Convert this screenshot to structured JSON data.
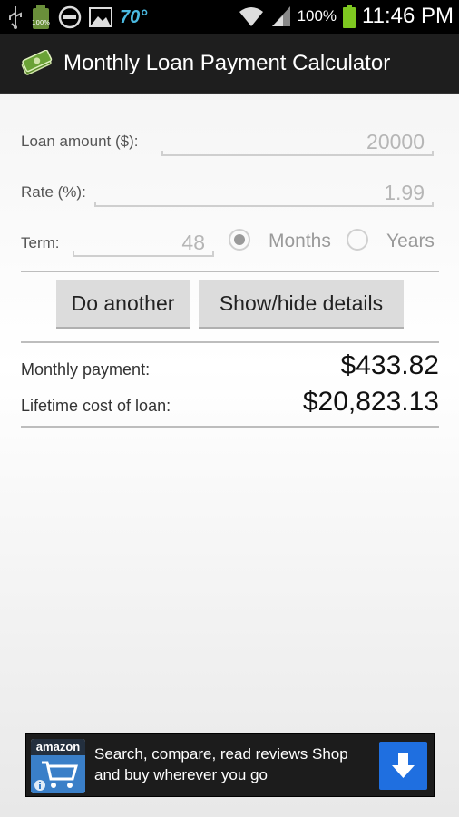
{
  "status_bar": {
    "temperature": "70°",
    "battery_percent": "100%",
    "time": "11:46 PM",
    "icons": [
      "usb-icon",
      "battery-app-icon",
      "do-not-disturb-icon",
      "gallery-icon",
      "wifi-icon",
      "signal-icon",
      "battery-icon"
    ]
  },
  "app": {
    "title": "Monthly Loan Payment Calculator",
    "icon": "money-icon"
  },
  "form": {
    "loan_amount_label": "Loan amount ($):",
    "loan_amount_value": "20000",
    "rate_label": "Rate (%):",
    "rate_value": "1.99",
    "term_label": "Term:",
    "term_value": "48",
    "months_label": "Months",
    "years_label": "Years",
    "selected_term_unit": "Months"
  },
  "buttons": {
    "do_another": "Do another",
    "show_hide_details": "Show/hide details"
  },
  "results": {
    "monthly_payment_label": "Monthly payment:",
    "monthly_payment_value": "$433.82",
    "lifetime_cost_label": "Lifetime cost of loan:",
    "lifetime_cost_value": "$20,823.13"
  },
  "ad": {
    "logo_text": "amazon",
    "text": "Search, compare, read reviews Shop and buy wherever you go",
    "icons": [
      "amazon-cart-icon",
      "info-icon",
      "download-arrow-icon"
    ]
  },
  "colors": {
    "action_bar": "#1e1e1e",
    "temperature": "#4ab9e0",
    "battery": "#7ec820",
    "download_button": "#1f6fe0"
  }
}
